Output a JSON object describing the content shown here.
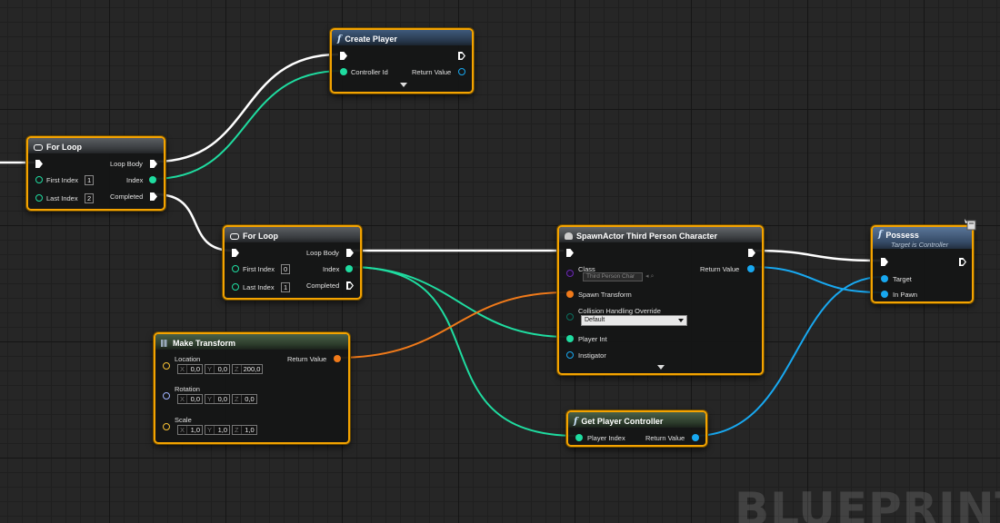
{
  "nodes": {
    "create_player": {
      "title": "Create Player",
      "pins": {
        "controller_id": "Controller Id",
        "return_value": "Return Value"
      }
    },
    "for_loop_1": {
      "title": "For Loop",
      "pins": {
        "first_index": "First Index",
        "first_index_value": "1",
        "last_index": "Last Index",
        "last_index_value": "2",
        "loop_body": "Loop Body",
        "index": "Index",
        "completed": "Completed"
      }
    },
    "for_loop_2": {
      "title": "For Loop",
      "pins": {
        "first_index": "First Index",
        "first_index_value": "0",
        "last_index": "Last Index",
        "last_index_value": "1",
        "loop_body": "Loop Body",
        "index": "Index",
        "completed": "Completed"
      }
    },
    "spawn_actor": {
      "title": "SpawnActor Third Person Character",
      "pins": {
        "class": "Class",
        "class_value": "Third Person Char",
        "spawn_transform": "Spawn Transform",
        "collision": "Collision Handling Override",
        "collision_value": "Default",
        "player_int": "Player Int",
        "instigator": "Instigator",
        "return_value": "Return Value"
      }
    },
    "possess": {
      "title": "Possess",
      "subtitle": "Target is Controller",
      "pins": {
        "target": "Target",
        "in_pawn": "In Pawn"
      }
    },
    "make_transform": {
      "title": "Make Transform",
      "pins": {
        "location": "Location",
        "rotation": "Rotation",
        "scale": "Scale",
        "return_value": "Return Value",
        "location_values": {
          "x": "0,0",
          "y": "0,0",
          "z": "200,0"
        },
        "rotation_values": {
          "x": "0,0",
          "y": "0,0",
          "z": "0,0"
        },
        "scale_values": {
          "x": "1,0",
          "y": "1,0",
          "z": "1,0"
        },
        "axis_x": "X",
        "axis_y": "Y",
        "axis_z": "Z"
      }
    },
    "get_player_controller": {
      "title": "Get Player Controller",
      "pins": {
        "player_index": "Player Index",
        "return_value": "Return Value"
      }
    }
  },
  "watermark": "BLUEPRINT",
  "colors": {
    "node_border": "#f4a300",
    "exec_wire": "#ffffff",
    "int_pin": "#1fdca0",
    "object_pin": "#18a8f0",
    "struct_pin": "#f07a1a",
    "vector_pin": "#f8c234",
    "rotator_pin": "#a0b4ff",
    "class_pin": "#6a2bb0",
    "byte_pin": "#0b6e5e"
  },
  "icons": {
    "function": "function-icon",
    "loop": "macro-loop-icon",
    "struct": "make-struct-icon",
    "spawn": "spawn-icon"
  }
}
